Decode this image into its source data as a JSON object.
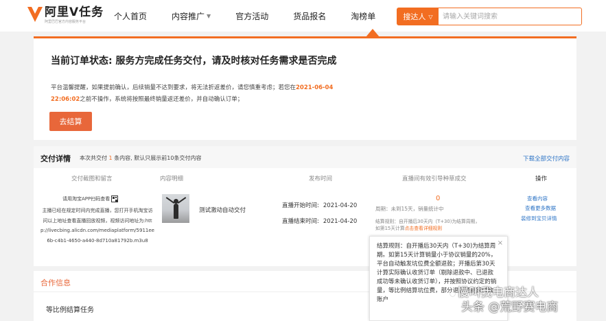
{
  "header": {
    "logo_title": "阿里V任务",
    "logo_sub": "阿里巴巴官方内容服务平台",
    "nav": [
      {
        "label": "个人首页",
        "dropdown": false
      },
      {
        "label": "内容推广",
        "dropdown": true
      },
      {
        "label": "官方活动",
        "dropdown": false
      },
      {
        "label": "货品报名",
        "dropdown": false
      },
      {
        "label": "淘榜单",
        "dropdown": false
      }
    ],
    "search": {
      "select_label": "搜达人",
      "placeholder": "请输入关键词搜索"
    }
  },
  "status": {
    "title": "当前订单状态: 服务方完成任务交付，请及时核对任务需求是否完成",
    "notice_part1": "平台温馨提醒，如果提前确认，后续销量不达到要求，将无法折返差价，请您慎重考虑；若您在",
    "notice_date": "2021-06-04 22:06:02",
    "notice_part2": "之前不操作，系统将按照最终销量返还差价，并自动确认订单；",
    "settle_button": "去结算"
  },
  "delivery": {
    "title": "交付详情",
    "summary_prefix": "本次共交付",
    "summary_count": "1",
    "summary_suffix": "条内容, 默认只展示前10条交付内容",
    "download_link": "下载全部交付内容",
    "columns": [
      "交付截图和留言",
      "内容明细",
      "发布时间",
      "直播间有效引导种草成交",
      "操作"
    ],
    "row": {
      "qr_prompt": "请用淘宝APP扫码查看",
      "message": "主播已经在规定时间内完成直播，您打开手机淘宝访问以上地址查看直播回放视频，视频访问地址为:http://livecbing.alicdn.com/mediaplatform/5911ee6b-c4b1-4650-a440-8d710a81792b.m3u8",
      "content_name": "测试激动自动交付",
      "live_start_label": "直播开始时间:",
      "live_start": "2021-04-20",
      "live_end_label": "直播结束时间:",
      "live_end": "2021-04-20",
      "deal_value": "0",
      "period_note": "周期：未到15天，销量统计中",
      "rule_note": "结算规则：自开播后30天内（T+30)为结算周期，",
      "rule_note2_prefix": "如第15天计算",
      "rule_link": "点击查看详细规则",
      "ops": [
        "查看内容",
        "查看更多数据",
        "装修到宝贝详情"
      ]
    }
  },
  "popover": {
    "text": "结算规则：自开播后30天内（T+30)为结算周期。如第15天计算销量小于协议销量的20%，平台自动触发坑位费全额退款；开播后第30天计算实际确认收货订单（剔除退款中、已退款成功等未确认收货订单），并按照协议约定的销量，等比例结算坑位费，部分退还至商家付款账户",
    "close": "×"
  },
  "cooperation": {
    "title": "合作信息",
    "task": "等比例结算任务"
  },
  "watermark": {
    "line1": "慢叫我电商达人",
    "line2": "头条 @荒野赛电商"
  },
  "colors": {
    "accent": "#f26d21",
    "link": "#2d74c6"
  }
}
